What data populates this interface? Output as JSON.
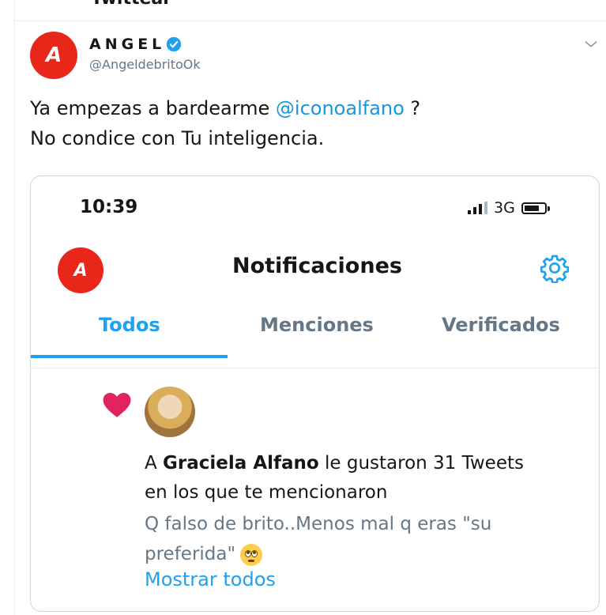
{
  "header": {
    "title": "Twittear"
  },
  "tweet": {
    "avatar_letter": "A",
    "author_name": "ANGEL",
    "handle": "@AngeldebritoOk",
    "text_part1": "Ya empezas a bardearme ",
    "mention": "@iconoalfano",
    "text_part2": " ?",
    "text_line2": "No condice con Tu inteligencia."
  },
  "embedded_screenshot": {
    "status_time": "10:39",
    "network": "3G",
    "avatar_letter": "A",
    "title": "Notificaciones",
    "tabs": [
      {
        "label": "Todos",
        "active": true
      },
      {
        "label": "Menciones",
        "active": false
      },
      {
        "label": "Verificados",
        "active": false
      }
    ],
    "notification": {
      "prefix": "A ",
      "user": "Graciela Alfano",
      "suffix": " le gustaron 31 Tweets",
      "line2": "en los que te mencionaron",
      "quote_line1": "Q falso de brito..Menos mal q eras \"su",
      "quote_line2": "preferida\"",
      "show_all": "Mostrar todos"
    }
  },
  "colors": {
    "accent": "#1da1f2",
    "mention": "#1b95e0",
    "brand_red": "#e8261a",
    "like_heart": "#e0245e",
    "secondary_text": "#657786"
  },
  "icons": {
    "verified": "verified-badge-icon",
    "chevron": "chevron-down-icon",
    "gear": "gear-icon",
    "heart": "heart-icon",
    "signal": "signal-bars-icon",
    "battery": "battery-icon",
    "emoji": "flushed-face-emoji"
  }
}
